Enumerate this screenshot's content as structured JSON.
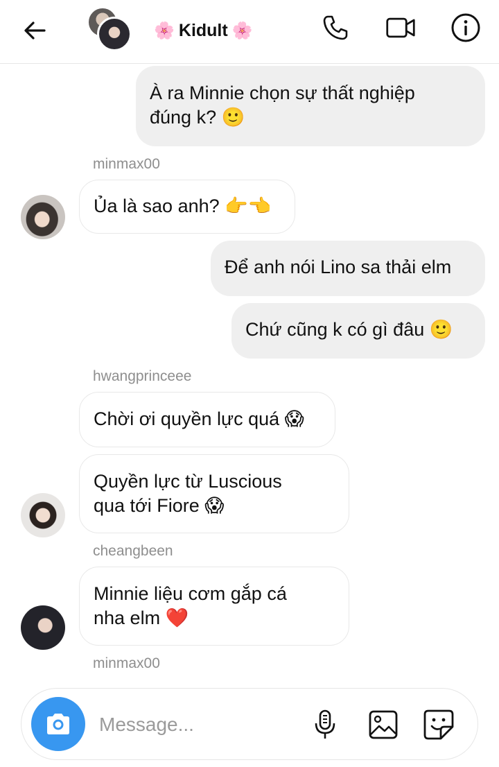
{
  "header": {
    "title": "Kidult",
    "flower_left": "🌸",
    "flower_right": "🌸",
    "icons": [
      "back-arrow-icon",
      "phone-icon",
      "video-camera-icon",
      "info-icon"
    ]
  },
  "messages": [
    {
      "type": "out",
      "text_lines": [
        "À ra Minnie chọn sự thất nghiệp",
        "đúng k? 🙂"
      ]
    },
    {
      "type": "sender",
      "name": "minmax00"
    },
    {
      "type": "in",
      "text": "Ủa là sao anh? 👉👈"
    },
    {
      "type": "out",
      "text": "Để anh nói Lino sa thải elm"
    },
    {
      "type": "out",
      "text": "Chứ cũng k có gì đâu 🙂"
    },
    {
      "type": "sender",
      "name": "hwangprinceee"
    },
    {
      "type": "in",
      "text": "Chời ơi quyền lực quá 😱"
    },
    {
      "type": "in",
      "text_lines": [
        "Quyền lực từ Luscious",
        "qua tới Fiore 😱"
      ]
    },
    {
      "type": "sender",
      "name": "cheangbeen"
    },
    {
      "type": "in",
      "text_lines": [
        "Minnie liệu cơm gắp cá",
        "nha elm ❤️"
      ]
    },
    {
      "type": "sender",
      "name": "minmax00"
    }
  ],
  "composer": {
    "placeholder": "Message...",
    "icons": [
      "camera-icon",
      "microphone-icon",
      "gallery-icon",
      "sticker-icon"
    ]
  },
  "colors": {
    "accent_blue": "#3897f0",
    "outgoing_bubble": "#efefef",
    "sender_gray": "#8e8e8e",
    "heart_red": "#e0245e"
  }
}
